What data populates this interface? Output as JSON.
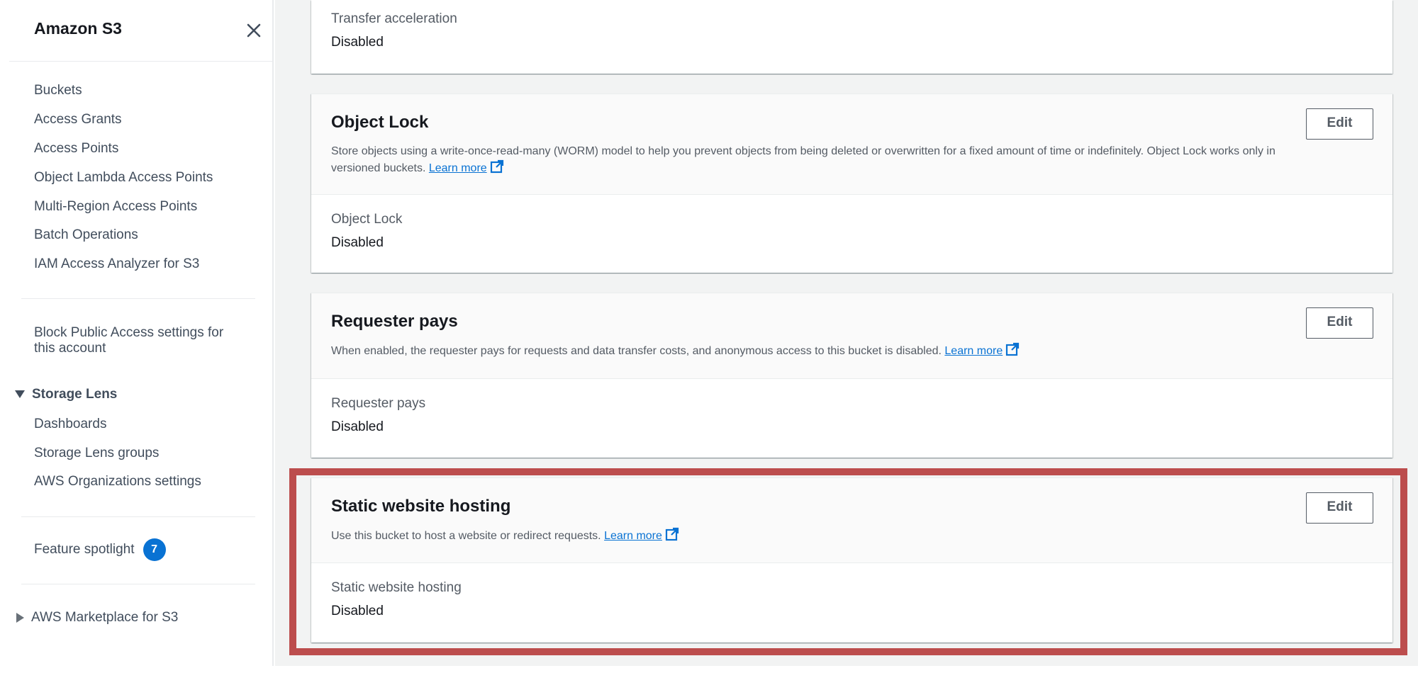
{
  "sidebar": {
    "title": "Amazon S3",
    "nav": [
      {
        "label": "Buckets"
      },
      {
        "label": "Access Grants"
      },
      {
        "label": "Access Points"
      },
      {
        "label": "Object Lambda Access Points"
      },
      {
        "label": "Multi-Region Access Points"
      },
      {
        "label": "Batch Operations"
      },
      {
        "label": "IAM Access Analyzer for S3"
      }
    ],
    "block_public_access_line1": "Block Public Access settings for",
    "block_public_access_line2": "this account",
    "storage_lens": {
      "label": "Storage Lens",
      "items": [
        {
          "label": "Dashboards"
        },
        {
          "label": "Storage Lens groups"
        },
        {
          "label": "AWS Organizations settings"
        }
      ]
    },
    "feature_spotlight": {
      "label": "Feature spotlight",
      "badge": "7"
    },
    "marketplace": "AWS Marketplace for S3"
  },
  "main": {
    "transfer_acceleration": {
      "label": "Transfer acceleration",
      "value": "Disabled"
    },
    "object_lock": {
      "title": "Object Lock",
      "description_line1": "Store objects using a write-once-read-many (WORM) model to help you prevent objects from being deleted or overwritten for a fixed amount of time or indefinitely. Object Lock works only in",
      "description_line2": "versioned buckets.",
      "learn_more": "Learn more",
      "edit": "Edit",
      "field_label": "Object Lock",
      "field_value": "Disabled"
    },
    "requester_pays": {
      "title": "Requester pays",
      "description": "When enabled, the requester pays for requests and data transfer costs, and anonymous access to this bucket is disabled.",
      "learn_more": "Learn more",
      "edit": "Edit",
      "field_label": "Requester pays",
      "field_value": "Disabled"
    },
    "static_website_hosting": {
      "title": "Static website hosting",
      "description": "Use this bucket to host a website or redirect requests.",
      "learn_more": "Learn more",
      "edit": "Edit",
      "field_label": "Static website hosting",
      "field_value": "Disabled"
    }
  },
  "colors": {
    "link": "#0972d3",
    "badge": "#0972d3",
    "highlight": "#bc4d4d"
  }
}
